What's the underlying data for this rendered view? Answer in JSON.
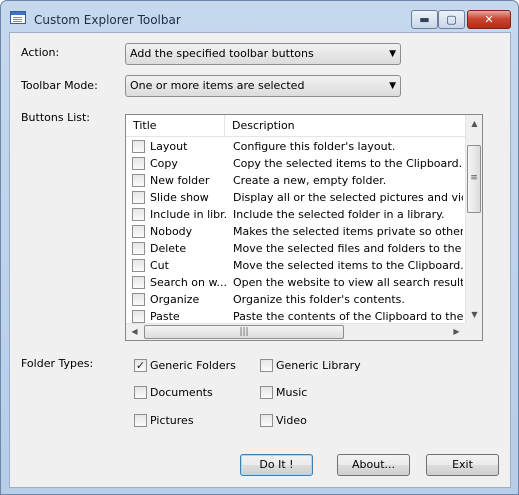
{
  "window": {
    "title": "Custom Explorer Toolbar",
    "minimize_glyph": "▬",
    "maximize_glyph": "▢",
    "close_glyph": "✕"
  },
  "action": {
    "label": "Action:",
    "value": "Add the specified toolbar buttons"
  },
  "toolbar_mode": {
    "label": "Toolbar Mode:",
    "value": "One or more items are selected"
  },
  "buttons_list": {
    "label": "Buttons List:",
    "columns": [
      "Title",
      "Description"
    ],
    "rows": [
      {
        "title": "Layout",
        "description": "Configure this folder's layout."
      },
      {
        "title": "Copy",
        "description": "Copy the selected items to the Clipboard."
      },
      {
        "title": "New folder",
        "description": "Create a new, empty folder."
      },
      {
        "title": "Slide show",
        "description": "Display all or the selected pictures and videos i..."
      },
      {
        "title": "Include in libr...",
        "description": "Include the selected folder in a library."
      },
      {
        "title": "Nobody",
        "description": "Makes the selected items private so other peo..."
      },
      {
        "title": "Delete",
        "description": "Move the selected files and folders to the Recy..."
      },
      {
        "title": "Cut",
        "description": "Move the selected items to the Clipboard."
      },
      {
        "title": "Search on w...",
        "description": "Open the website to view all search results."
      },
      {
        "title": "Organize",
        "description": "Organize this folder's contents."
      },
      {
        "title": "Paste",
        "description": "Paste the contents of the Clipboard to the curr..."
      }
    ]
  },
  "folder_types": {
    "label": "Folder Types:",
    "items": [
      {
        "label": "Generic Folders",
        "checked": true
      },
      {
        "label": "Generic Library",
        "checked": false
      },
      {
        "label": "Documents",
        "checked": false
      },
      {
        "label": "Music",
        "checked": false
      },
      {
        "label": "Pictures",
        "checked": false
      },
      {
        "label": "Video",
        "checked": false
      }
    ],
    "check_glyph": "✓"
  },
  "buttons": {
    "do_it": "Do It !",
    "about": "About...",
    "exit": "Exit"
  }
}
